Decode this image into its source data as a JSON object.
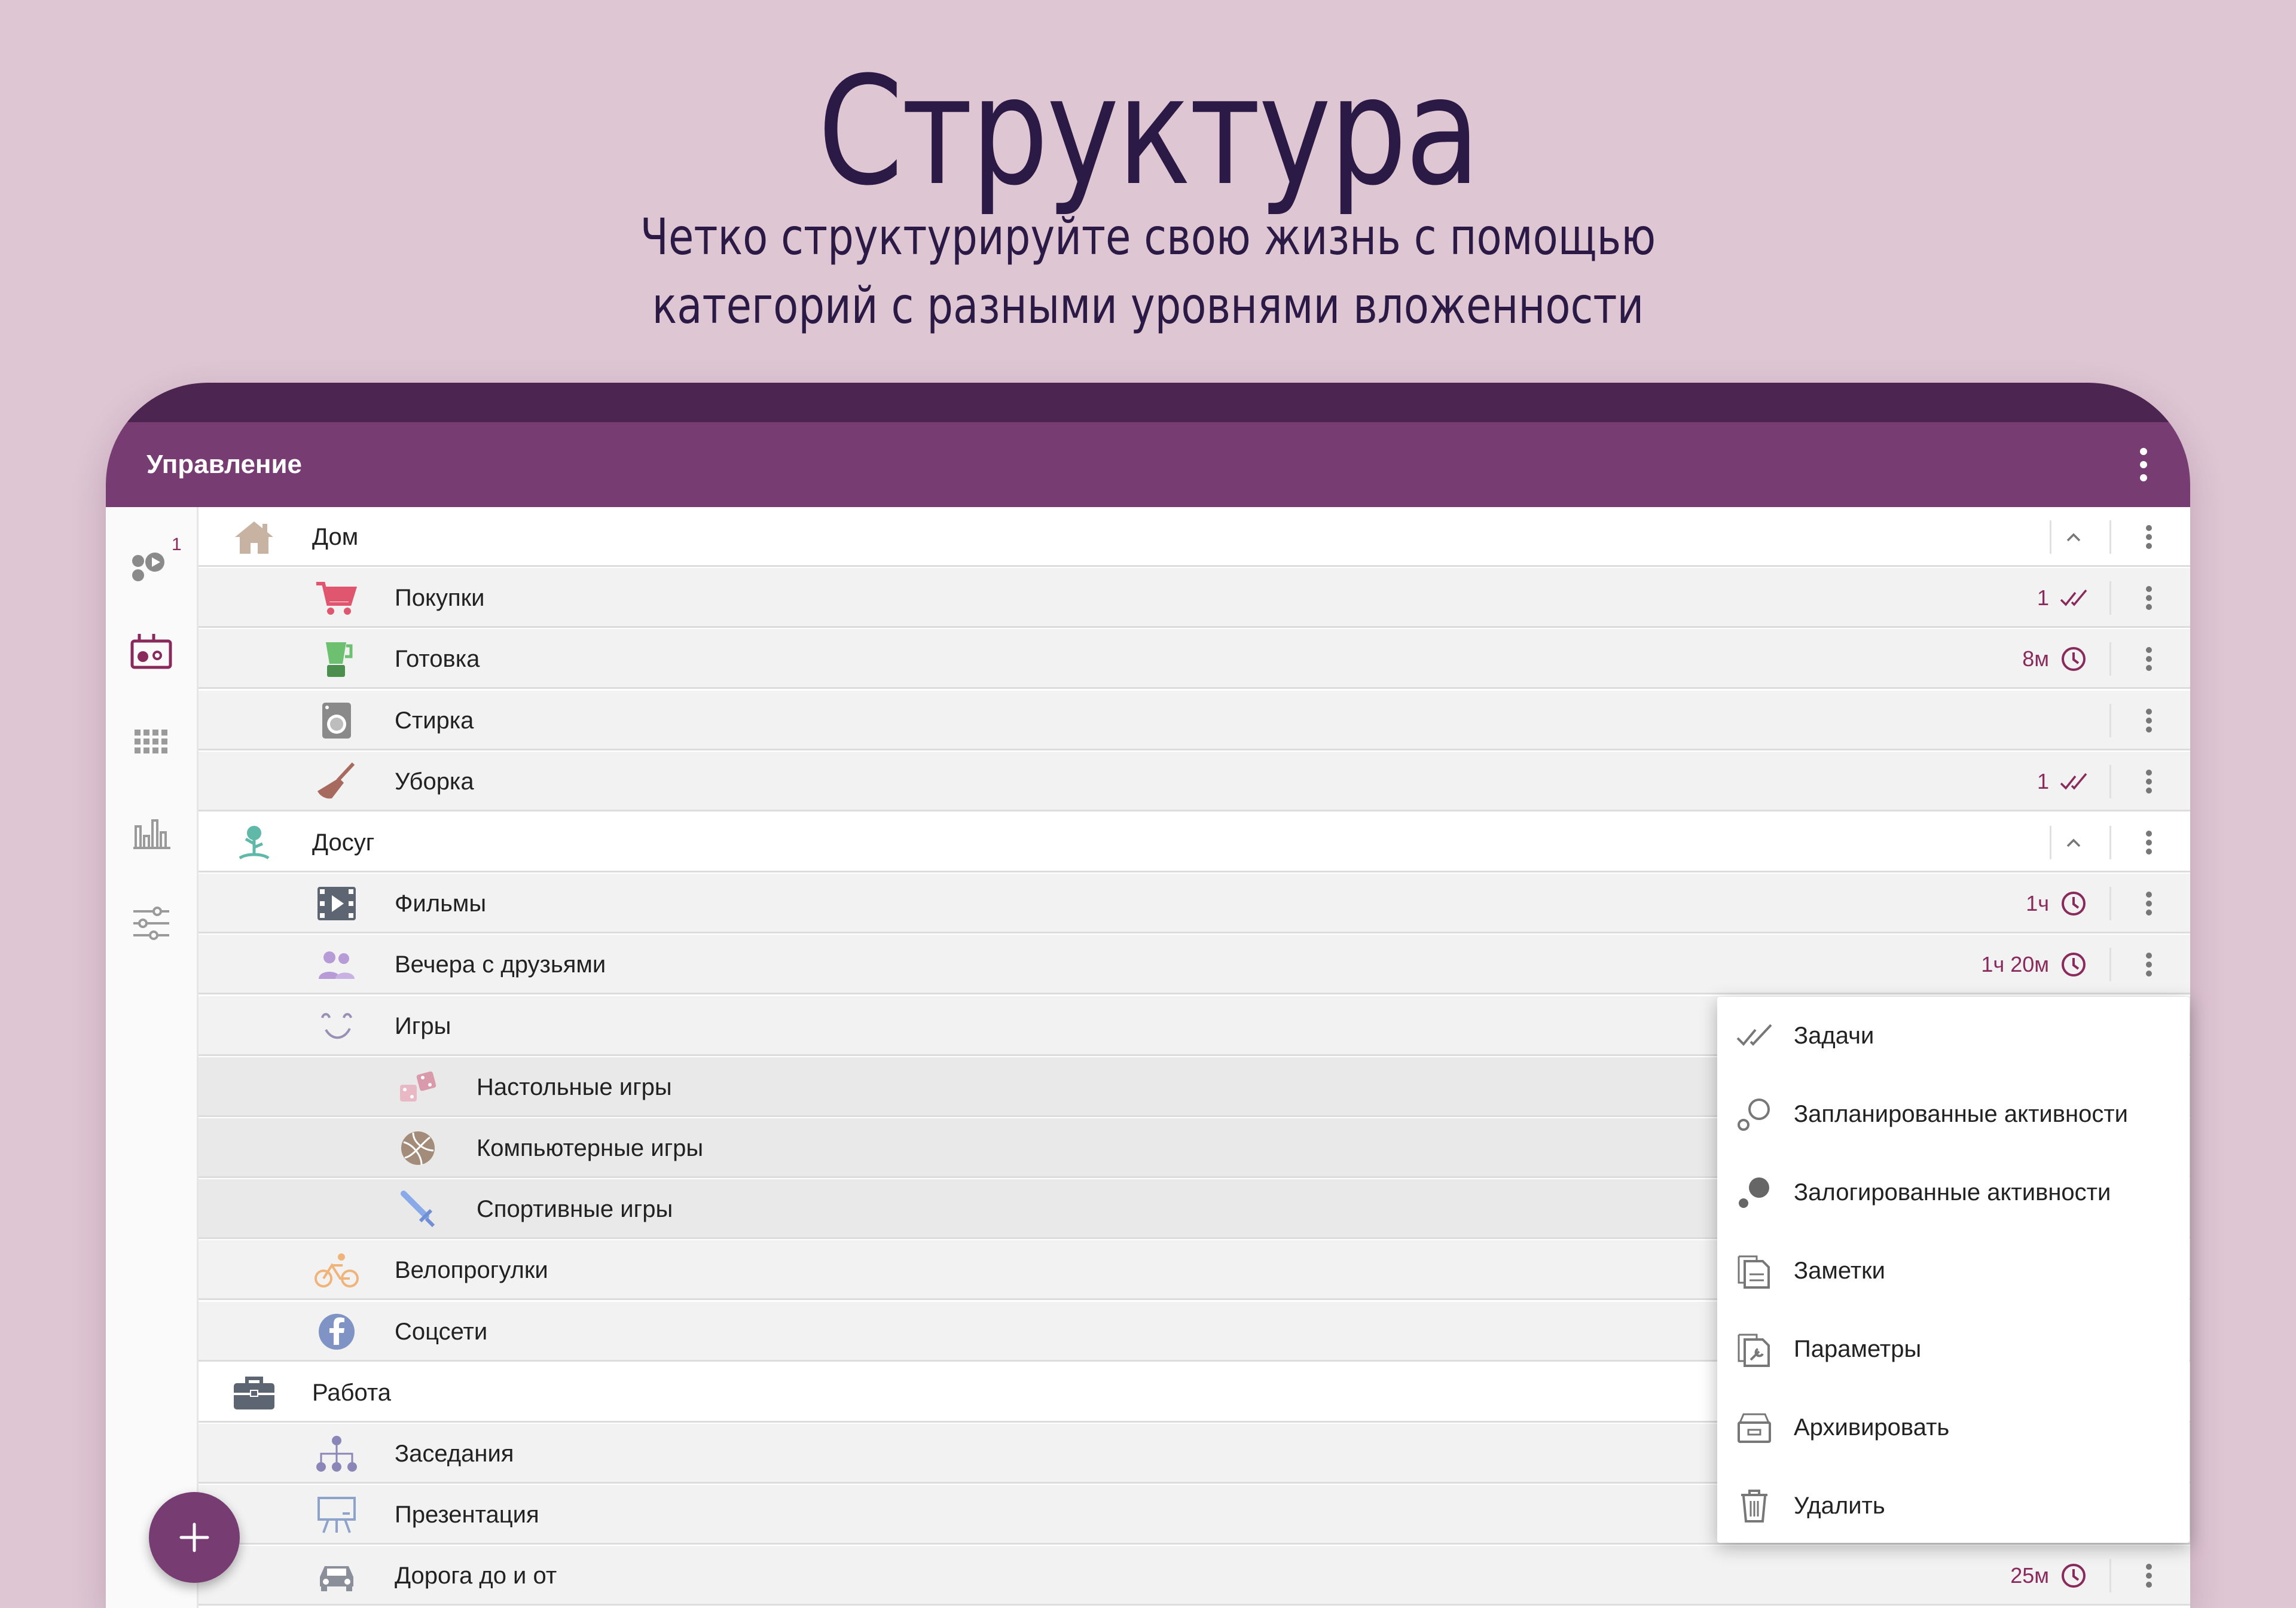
{
  "promo": {
    "title": "Структура",
    "subtitle_line1": "Четко структурируйте свою жизнь с помощью",
    "subtitle_line2": "категорий с разными уровнями вложенности"
  },
  "appbar": {
    "title": "Управление",
    "menu_icon": "more-vertical-icon"
  },
  "rail": {
    "badge": "1",
    "items": [
      "activities-icon",
      "planner-icon",
      "grid-icon",
      "statistics-icon",
      "settings-sliders-icon"
    ]
  },
  "categories": [
    {
      "label": "Дом",
      "level": 0,
      "icon": "house-icon",
      "expanded": true
    },
    {
      "label": "Покупки",
      "level": 1,
      "icon": "cart-icon",
      "count": "1",
      "meta": "tasks"
    },
    {
      "label": "Готовка",
      "level": 1,
      "icon": "blender-icon",
      "time": "8м",
      "meta": "time"
    },
    {
      "label": "Стирка",
      "level": 1,
      "icon": "washing-machine-icon"
    },
    {
      "label": "Уборка",
      "level": 1,
      "icon": "broom-icon",
      "count": "1",
      "meta": "tasks"
    },
    {
      "label": "Досуг",
      "level": 0,
      "icon": "tree-icon",
      "expanded": true
    },
    {
      "label": "Фильмы",
      "level": 1,
      "icon": "film-icon",
      "time": "1ч",
      "meta": "time"
    },
    {
      "label": "Вечера с друзьями",
      "level": 1,
      "icon": "people-icon",
      "time": "1ч 20м",
      "meta": "time"
    },
    {
      "label": "Игры",
      "level": 1,
      "icon": "smile-icon"
    },
    {
      "label": "Настольные игры",
      "level": 2,
      "icon": "dice-icon"
    },
    {
      "label": "Компьютерные игры",
      "level": 2,
      "icon": "ball-icon"
    },
    {
      "label": "Спортивные игры",
      "level": 2,
      "icon": "sword-icon"
    },
    {
      "label": "Велопрогулки",
      "level": 1,
      "icon": "bicycle-icon"
    },
    {
      "label": "Соцсети",
      "level": 1,
      "icon": "facebook-icon"
    },
    {
      "label": "Работа",
      "level": 0,
      "icon": "briefcase-icon"
    },
    {
      "label": "Заседания",
      "level": 1,
      "icon": "org-chart-icon"
    },
    {
      "label": "Презентация",
      "level": 1,
      "icon": "easel-icon"
    },
    {
      "label": "Дорога до и от",
      "level": 1,
      "icon": "car-icon",
      "time": "25м",
      "meta": "time"
    }
  ],
  "context_menu": [
    {
      "label": "Задачи",
      "icon": "tasks-check-icon"
    },
    {
      "label": "Запланированные активности",
      "icon": "planned-circles-icon"
    },
    {
      "label": "Залогированные активности",
      "icon": "logged-circles-icon"
    },
    {
      "label": "Заметки",
      "icon": "notes-icon"
    },
    {
      "label": "Параметры",
      "icon": "parameters-icon"
    },
    {
      "label": "Архивировать",
      "icon": "archive-icon"
    },
    {
      "label": "Удалить",
      "icon": "trash-icon"
    }
  ],
  "fab": {
    "icon": "plus-icon"
  },
  "colors": {
    "primary": "#773c72",
    "primary_dark": "#4c2650",
    "accent": "#8a2a5c",
    "background": "#dfc6d3"
  }
}
